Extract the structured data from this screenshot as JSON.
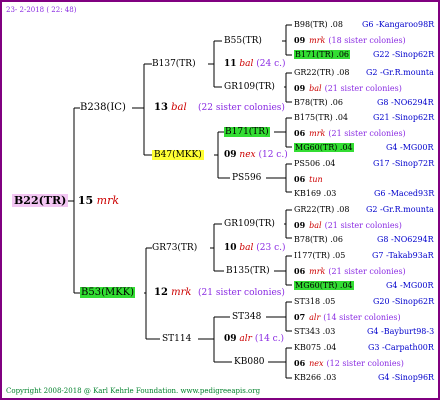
{
  "header": {
    "date": "23-  2-2018 ( 22: 48)"
  },
  "footer": {
    "copyright": "Copyright 2008-2018 @ Karl Kehrle Foundation.   www.pedigreeapis.org"
  },
  "root": {
    "id": "B22(TR)",
    "num": "15",
    "code": "mrk"
  },
  "gen1": [
    {
      "id": "B238(IC)",
      "num": "13",
      "code": "bal",
      "sister": "(22 sister colonies)"
    },
    {
      "id": "B53(MKK)",
      "num": "12",
      "code": "mrk",
      "sister": "(21 sister colonies)"
    }
  ],
  "gen2": [
    {
      "id": "B137(TR)",
      "num": "11",
      "code": "bal",
      "sister": "(24 c.)"
    },
    {
      "id": "B47(MKK)",
      "num": "09",
      "code": "nex",
      "sister": "(12 c.)"
    },
    {
      "id": "GR73(TR)",
      "num": "10",
      "code": "bal",
      "sister": "(23 c.)"
    },
    {
      "id": "ST114",
      "num": "09",
      "code": "alr",
      "sister": "(14 c.)"
    }
  ],
  "gen3": [
    {
      "id": "B55(TR)"
    },
    {
      "id": "GR109(TR)"
    },
    {
      "id": "B171(TR)"
    },
    {
      "id": "PS596"
    },
    {
      "id": "GR109(TR)"
    },
    {
      "id": "B135(TR)"
    },
    {
      "id": "ST348"
    },
    {
      "id": "KB080"
    }
  ],
  "gen4": [
    {
      "a": "B98(TR) .08",
      "b": "G6 -Kangaroo98R"
    },
    {
      "num": "09",
      "code": "mrk",
      "sister": "(18 sister colonies)"
    },
    {
      "a": "B171(TR) .06",
      "b": "G22 -Sinop62R"
    },
    {
      "a": "GR22(TR) .08",
      "b": "G2 -Gr.R.mounta"
    },
    {
      "num": "09",
      "code": "bal",
      "sister": "(21 sister colonies)"
    },
    {
      "a": "B78(TR) .06",
      "b": "G8 -NO6294R"
    },
    {
      "a": "B175(TR) .04",
      "b": "G21 -Sinop62R"
    },
    {
      "num": "06",
      "code": "mrk",
      "sister": "(21 sister colonies)"
    },
    {
      "a": "MG60(TR) .04",
      "b": "G4 -MG00R"
    },
    {
      "a": "PS506 .04",
      "b": "G17 -Sinop72R"
    },
    {
      "num": "06",
      "code": "tun",
      "sister": ""
    },
    {
      "a": "KB169 .03",
      "b": "G6 -Maced93R"
    },
    {
      "a": "GR22(TR) .08",
      "b": "G2 -Gr.R.mounta"
    },
    {
      "num": "09",
      "code": "bal",
      "sister": "(21 sister colonies)"
    },
    {
      "a": "B78(TR) .06",
      "b": "G8 -NO6294R"
    },
    {
      "a": "I177(TR) .05",
      "b": "G7 -Takab93aR"
    },
    {
      "num": "06",
      "code": "mrk",
      "sister": "(21 sister colonies)"
    },
    {
      "a": "MG60(TR) .04",
      "b": "G4 -MG00R"
    },
    {
      "a": "ST318 .05",
      "b": "G20 -Sinop62R"
    },
    {
      "num": "07",
      "code": "alr",
      "sister": "(14 sister colonies)"
    },
    {
      "a": "ST343 .03",
      "b": "G4 -Bayburt98-3"
    },
    {
      "a": "KB075 .04",
      "b": "G3 -Carpath00R"
    },
    {
      "num": "06",
      "code": "nex",
      "sister": "(12 sister colonies)"
    },
    {
      "a": "KB266 .03",
      "b": "G4 -Sinop96R"
    }
  ],
  "colors": {
    "frame": "#800080",
    "highlight_green": "#33dd33",
    "highlight_yellow": "#ffff33",
    "root_highlight": "#f3c6f3",
    "code_red": "#cc0000",
    "link_blue": "#0000cc"
  }
}
